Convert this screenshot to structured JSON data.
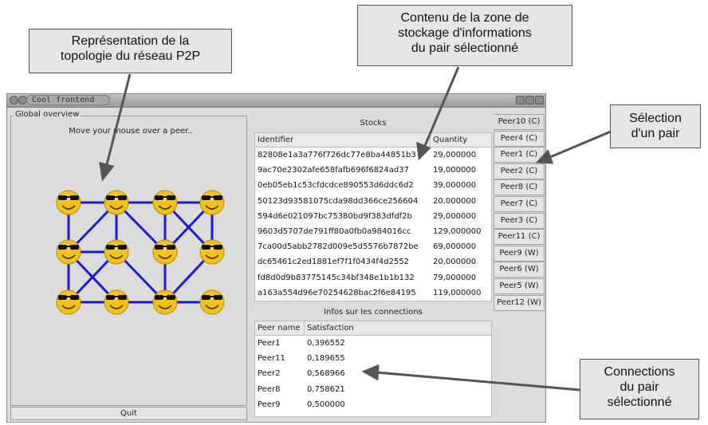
{
  "callouts": {
    "topology": "Représentation de la\ntopologie du réseau P2P",
    "storage": "Contenu de la zone de\nstockage d'informations\ndu pair sélectionné",
    "selection": "Sélection\nd'un pair",
    "connections": "Connections\ndu pair\nsélectionné"
  },
  "window": {
    "title": "Cool frontend"
  },
  "overview": {
    "label": "Global overview",
    "hint": "Move your mouse over a peer..",
    "quit": "Quit",
    "peer_icon": "smiley-with-sunglasses-icon",
    "edge_color": "#1a1ad6"
  },
  "stocks": {
    "title": "Stocks",
    "headers": [
      "Identifier",
      "Quantity"
    ],
    "rows": [
      [
        "82808e1a3a776f726dc77e8ba44851b3",
        "29,000000"
      ],
      [
        "9ac70e2302afe658fafb696f6824ad37",
        "19,000000"
      ],
      [
        "0eb05eb1c53cfdcdce890553d6ddc6d2",
        "39,000000"
      ],
      [
        "50123d93581075cda98dd366ce256604",
        "20,000000"
      ],
      [
        "594d6e021097bc75380bd9f383dfdf2b",
        "29,000000"
      ],
      [
        "9603d5707de791ff80a0fb0a984016cc",
        "129,000000"
      ],
      [
        "7ca00d5abb2782d009e5d5576b7872be",
        "69,000000"
      ],
      [
        "dc65461c2ed1881ef7f1f0434f4d2552",
        "20,000000"
      ],
      [
        "fd8d0d9b83775145c34bf348e1b1b132",
        "79,000000"
      ],
      [
        "a163a554d96e70254628bac2f6e84195",
        "119,000000"
      ]
    ]
  },
  "connections": {
    "title": "Infos sur les connections",
    "headers": [
      "Peer name",
      "Satisfaction"
    ],
    "rows": [
      [
        "Peer1",
        "0,396552"
      ],
      [
        "Peer11",
        "0,189655"
      ],
      [
        "Peer2",
        "0,568966"
      ],
      [
        "Peer8",
        "0,758621"
      ],
      [
        "Peer9",
        "0,500000"
      ]
    ]
  },
  "tabs": [
    "Peer10 (C)",
    "Peer4 (C)",
    "Peer1 (C)",
    "Peer2 (C)",
    "Peer8 (C)",
    "Peer7 (C)",
    "Peer3 (C)",
    "Peer11 (C)",
    "Peer9 (W)",
    "Peer6 (W)",
    "Peer5 (W)",
    "Peer12 (W)"
  ]
}
